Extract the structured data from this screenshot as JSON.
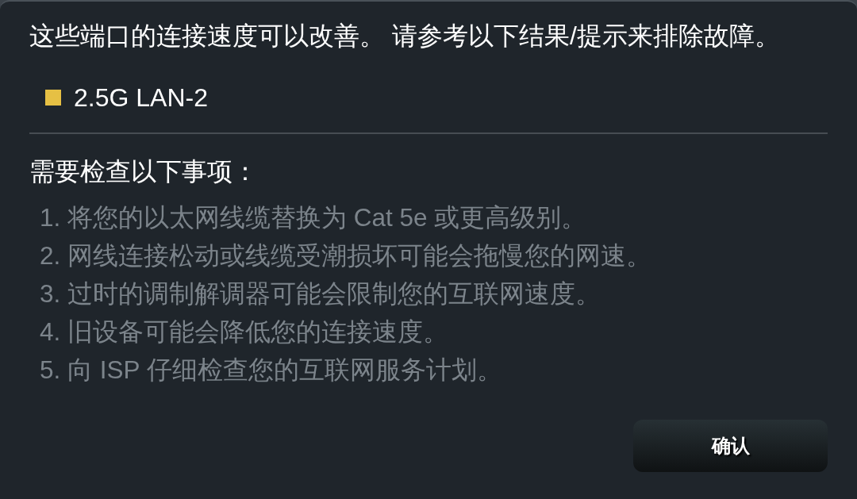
{
  "message": "这些端口的连接速度可以改善。 请参考以下结果/提示来排除故障。",
  "ports": [
    {
      "name": "2.5G LAN-2",
      "color": "#e6c044"
    }
  ],
  "checklist": {
    "title": "需要检查以下事项：",
    "items": [
      "1. 将您的以太网线缆替换为 Cat 5e 或更高级别。",
      "2. 网线连接松动或线缆受潮损坏可能会拖慢您的网速。",
      "3. 过时的调制解调器可能会限制您的互联网速度。",
      "4. 旧设备可能会降低您的连接速度。",
      "5. 向 ISP 仔细检查您的互联网服务计划。"
    ]
  },
  "buttons": [
    {
      "label": "确认"
    }
  ]
}
